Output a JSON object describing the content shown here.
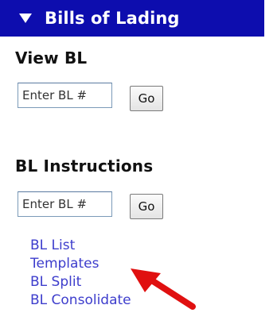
{
  "header": {
    "title": "Bills of Lading",
    "collapse_icon": "triangle-down-icon"
  },
  "view_bl": {
    "title": "View BL",
    "input_placeholder": "Enter BL #",
    "go_label": "Go"
  },
  "bl_instructions": {
    "title": "BL Instructions",
    "input_placeholder": "Enter BL #",
    "go_label": "Go"
  },
  "links": [
    {
      "label": "BL List"
    },
    {
      "label": "Templates"
    },
    {
      "label": "BL Split"
    },
    {
      "label": "BL Consolidate"
    }
  ],
  "annotation": {
    "icon": "red-arrow-icon",
    "color": "#e01010",
    "points_to": "Templates"
  },
  "colors": {
    "header_background": "#0d0dae",
    "link": "#3d3dcc"
  }
}
